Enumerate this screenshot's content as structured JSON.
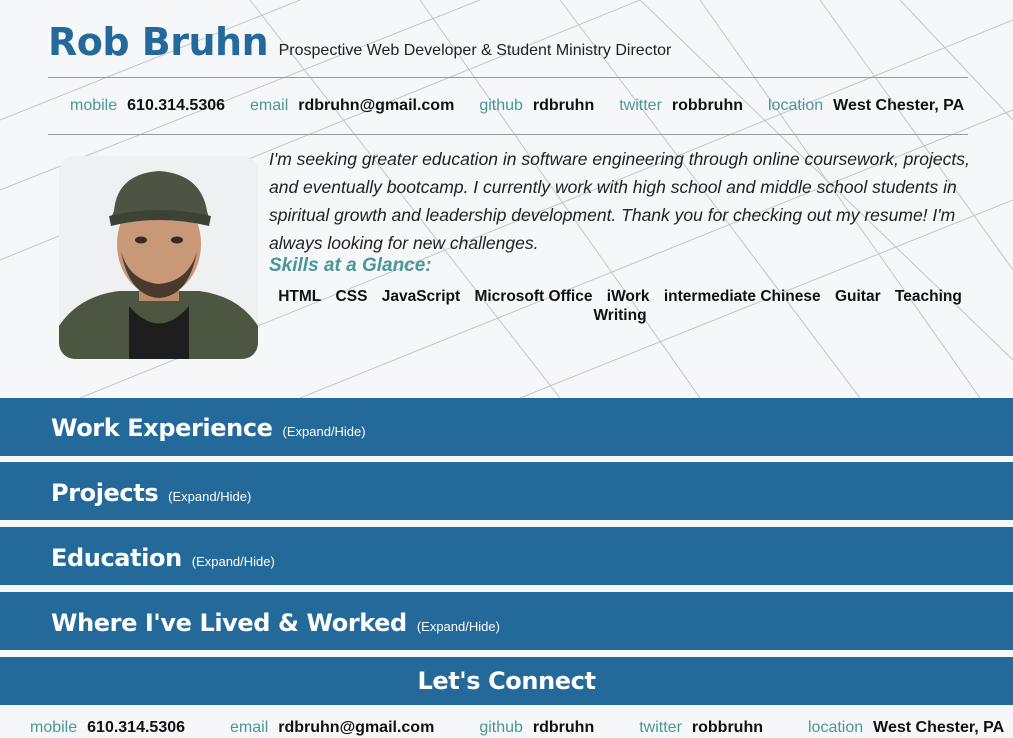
{
  "header": {
    "name": "Rob Bruhn",
    "subtitle": "Prospective Web Developer & Student Ministry Director"
  },
  "contact": [
    {
      "label": "mobile",
      "value": "610.314.5306"
    },
    {
      "label": "email",
      "value": "rdbruhn@gmail.com"
    },
    {
      "label": "github",
      "value": "rdbruhn"
    },
    {
      "label": "twitter",
      "value": "robbruhn"
    },
    {
      "label": "location",
      "value": "West Chester, PA"
    }
  ],
  "summary": " I'm seeking greater education in software engineering through online coursework, projects, and eventually bootcamp. I currently work with high school and middle school students in spiritual growth and leadership development. Thank you for checking out my resume! I'm always looking for new challenges.",
  "skills": {
    "title": "Skills at a Glance:",
    "items": [
      "HTML",
      "CSS",
      "JavaScript",
      "Microsoft Office",
      "iWork",
      "intermediate Chinese",
      "Guitar",
      "Teaching",
      "Writing"
    ]
  },
  "sections": [
    {
      "title": "Work Experience",
      "toggle": "(Expand/Hide)"
    },
    {
      "title": "Projects",
      "toggle": "(Expand/Hide)"
    },
    {
      "title": "Education",
      "toggle": "(Expand/Hide)"
    },
    {
      "title": "Where I've Lived & Worked",
      "toggle": "(Expand/Hide)"
    }
  ],
  "connect": {
    "title": "Let's Connect"
  },
  "colors": {
    "accent": "#236a9b",
    "label": "#4a9797"
  },
  "icons": {
    "photo": "profile-photo"
  }
}
